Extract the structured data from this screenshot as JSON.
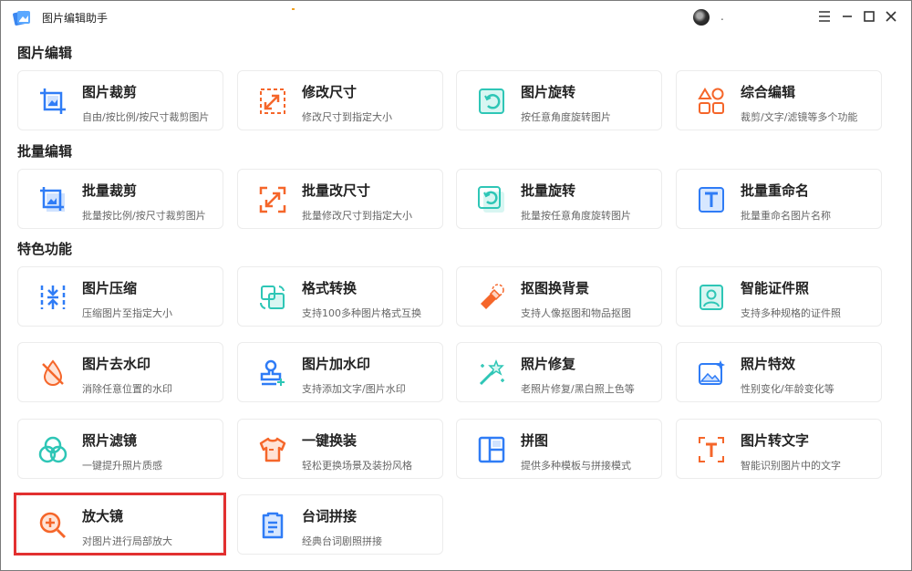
{
  "app": {
    "title": "图片编辑助手",
    "user_name": "."
  },
  "colors": {
    "accent_blue": "#2f7cf6",
    "accent_orange": "#f5662a",
    "accent_teal": "#2ec6b6",
    "highlight_red": "#e23030"
  },
  "sections": [
    {
      "title": "图片编辑"
    },
    {
      "title": "批量编辑"
    },
    {
      "title": "特色功能"
    }
  ],
  "tools": [
    {
      "name": "图片裁剪",
      "desc": "自由/按比例/按尺寸裁剪图片",
      "icon": "crop-icon"
    },
    {
      "name": "修改尺寸",
      "desc": "修改尺寸到指定大小",
      "icon": "resize-icon"
    },
    {
      "name": "图片旋转",
      "desc": "按任意角度旋转图片",
      "icon": "rotate-icon"
    },
    {
      "name": "综合编辑",
      "desc": "裁剪/文字/滤镜等多个功能",
      "icon": "shapes-icon"
    },
    {
      "name": "批量裁剪",
      "desc": "批量按比例/按尺寸裁剪图片",
      "icon": "batch-crop-icon"
    },
    {
      "name": "批量改尺寸",
      "desc": "批量修改尺寸到指定大小",
      "icon": "batch-resize-icon"
    },
    {
      "name": "批量旋转",
      "desc": "批量按任意角度旋转图片",
      "icon": "batch-rotate-icon"
    },
    {
      "name": "批量重命名",
      "desc": "批量重命名图片名称",
      "icon": "rename-icon"
    },
    {
      "name": "图片压缩",
      "desc": "压缩图片至指定大小",
      "icon": "compress-icon"
    },
    {
      "name": "格式转换",
      "desc": "支持100多种图片格式互换",
      "icon": "convert-icon"
    },
    {
      "name": "抠图换背景",
      "desc": "支持人像抠图和物品抠图",
      "icon": "eraser-icon"
    },
    {
      "name": "智能证件照",
      "desc": "支持多种规格的证件照",
      "icon": "id-photo-icon"
    },
    {
      "name": "图片去水印",
      "desc": "消除任意位置的水印",
      "icon": "remove-watermark-icon"
    },
    {
      "name": "图片加水印",
      "desc": "支持添加文字/图片水印",
      "icon": "stamp-icon"
    },
    {
      "name": "照片修复",
      "desc": "老照片修复/黑白照上色等",
      "icon": "magic-wand-icon"
    },
    {
      "name": "照片特效",
      "desc": "性别变化/年龄变化等",
      "icon": "image-sparkle-icon"
    },
    {
      "name": "照片滤镜",
      "desc": "一键提升照片质感",
      "icon": "filter-icon"
    },
    {
      "name": "一键换装",
      "desc": "轻松更换场景及装扮风格",
      "icon": "shirt-icon"
    },
    {
      "name": "拼图",
      "desc": "提供多种模板与拼接模式",
      "icon": "collage-icon"
    },
    {
      "name": "图片转文字",
      "desc": "智能识别图片中的文字",
      "icon": "ocr-text-icon"
    },
    {
      "name": "放大镜",
      "desc": "对图片进行局部放大",
      "icon": "magnifier-icon"
    },
    {
      "name": "台词拼接",
      "desc": "经典台词剧照拼接",
      "icon": "document-icon"
    }
  ]
}
